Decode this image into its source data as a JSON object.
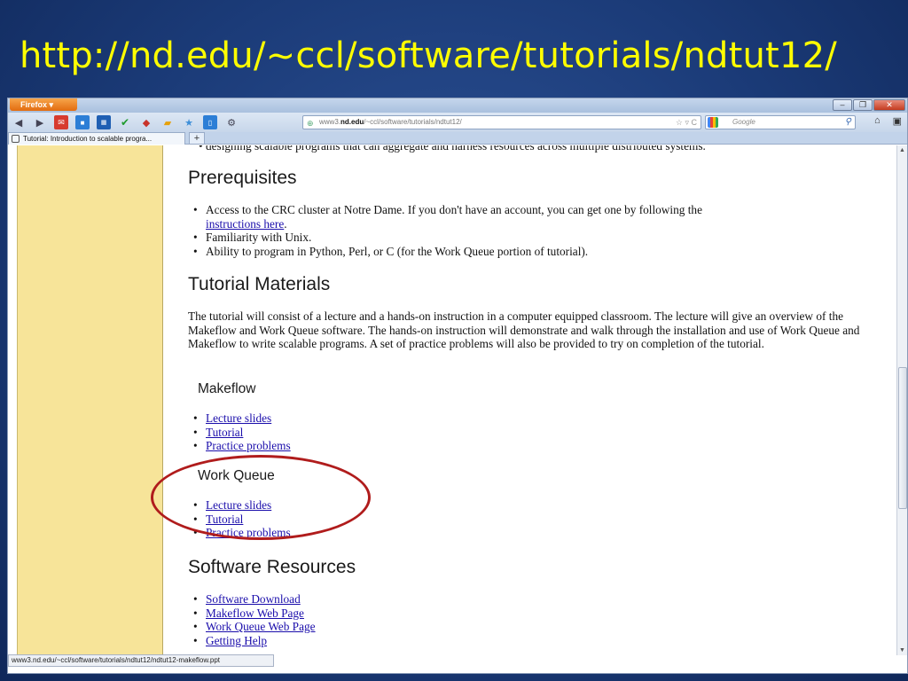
{
  "slide": {
    "title": "http://nd.edu/~ccl/software/tutorials/ndtut12/"
  },
  "browser": {
    "app_button": "Firefox",
    "url_prefix": "www3.",
    "url_domain": "nd.edu",
    "url_path": "/~ccl/software/tutorials/ndtut12/",
    "search_placeholder": "Google",
    "tab_title": "Tutorial: Introduction to scalable progra...",
    "new_tab": "+",
    "status_text": "www3.nd.edu/~ccl/software/tutorials/ndtut12/ndtut12-makeflow.ppt"
  },
  "page": {
    "cut_text": "designing scalable programs that can aggregate and harness resources across multiple distributed systems.",
    "prereq_heading": "Prerequisites",
    "prereq_items": [
      {
        "text": "Access to the CRC cluster at Notre Dame. If you don't have an account, you can get one by following the",
        "link": "instructions here",
        "after": "."
      },
      {
        "text": "Familiarity with Unix."
      },
      {
        "text": "Ability to program in Python, Perl, or C (for the Work Queue portion of tutorial)."
      }
    ],
    "materials_heading": "Tutorial Materials",
    "materials_paragraph": "The tutorial will consist of a lecture and a hands-on instruction in a computer equipped classroom. The lecture will give an overview of the Makeflow and Work Queue software. The hands-on instruction will demonstrate and walk through the installation and use of Work Queue and Makeflow to write scalable programs. A set of practice problems will also be provided to try on completion of the tutorial.",
    "makeflow_heading": "Makeflow",
    "makeflow_links": [
      "Lecture slides",
      "Tutorial",
      "Practice problems"
    ],
    "workqueue_heading": "Work Queue",
    "workqueue_links": [
      "Lecture slides",
      "Tutorial",
      "Practice problems"
    ],
    "resources_heading": "Software Resources",
    "resources_links": [
      "Software Download",
      "Makeflow Web Page",
      "Work Queue Web Page",
      "Getting Help"
    ]
  },
  "colors": {
    "slide_title": "#ffff00",
    "sidebar": "#f7e499",
    "highlight_ellipse": "#b01c1c",
    "link": "#1a0dab"
  }
}
